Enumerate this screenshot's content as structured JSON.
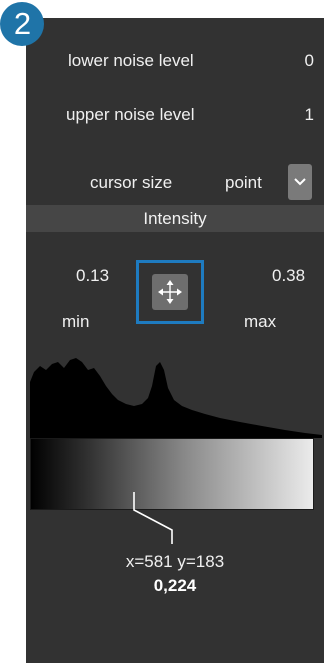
{
  "badge": {
    "number": "2"
  },
  "noise": {
    "lower_label": "lower noise level",
    "lower_value": "0",
    "upper_label": "upper noise level",
    "upper_value": "1"
  },
  "cursor": {
    "label": "cursor size",
    "selected": "point"
  },
  "intensity": {
    "header": "Intensity",
    "min_value": "0.13",
    "min_label": "min",
    "max_value": "0.38",
    "max_label": "max"
  },
  "readout": {
    "coords": "x=581 y=183",
    "value": "0,224"
  },
  "colors": {
    "badge": "#1f74a8",
    "panel": "#323232",
    "selection_border": "#1e7bc0",
    "header": "#464646"
  },
  "icons": {
    "move": "move-arrows-icon",
    "dropdown": "chevron-down-icon"
  }
}
